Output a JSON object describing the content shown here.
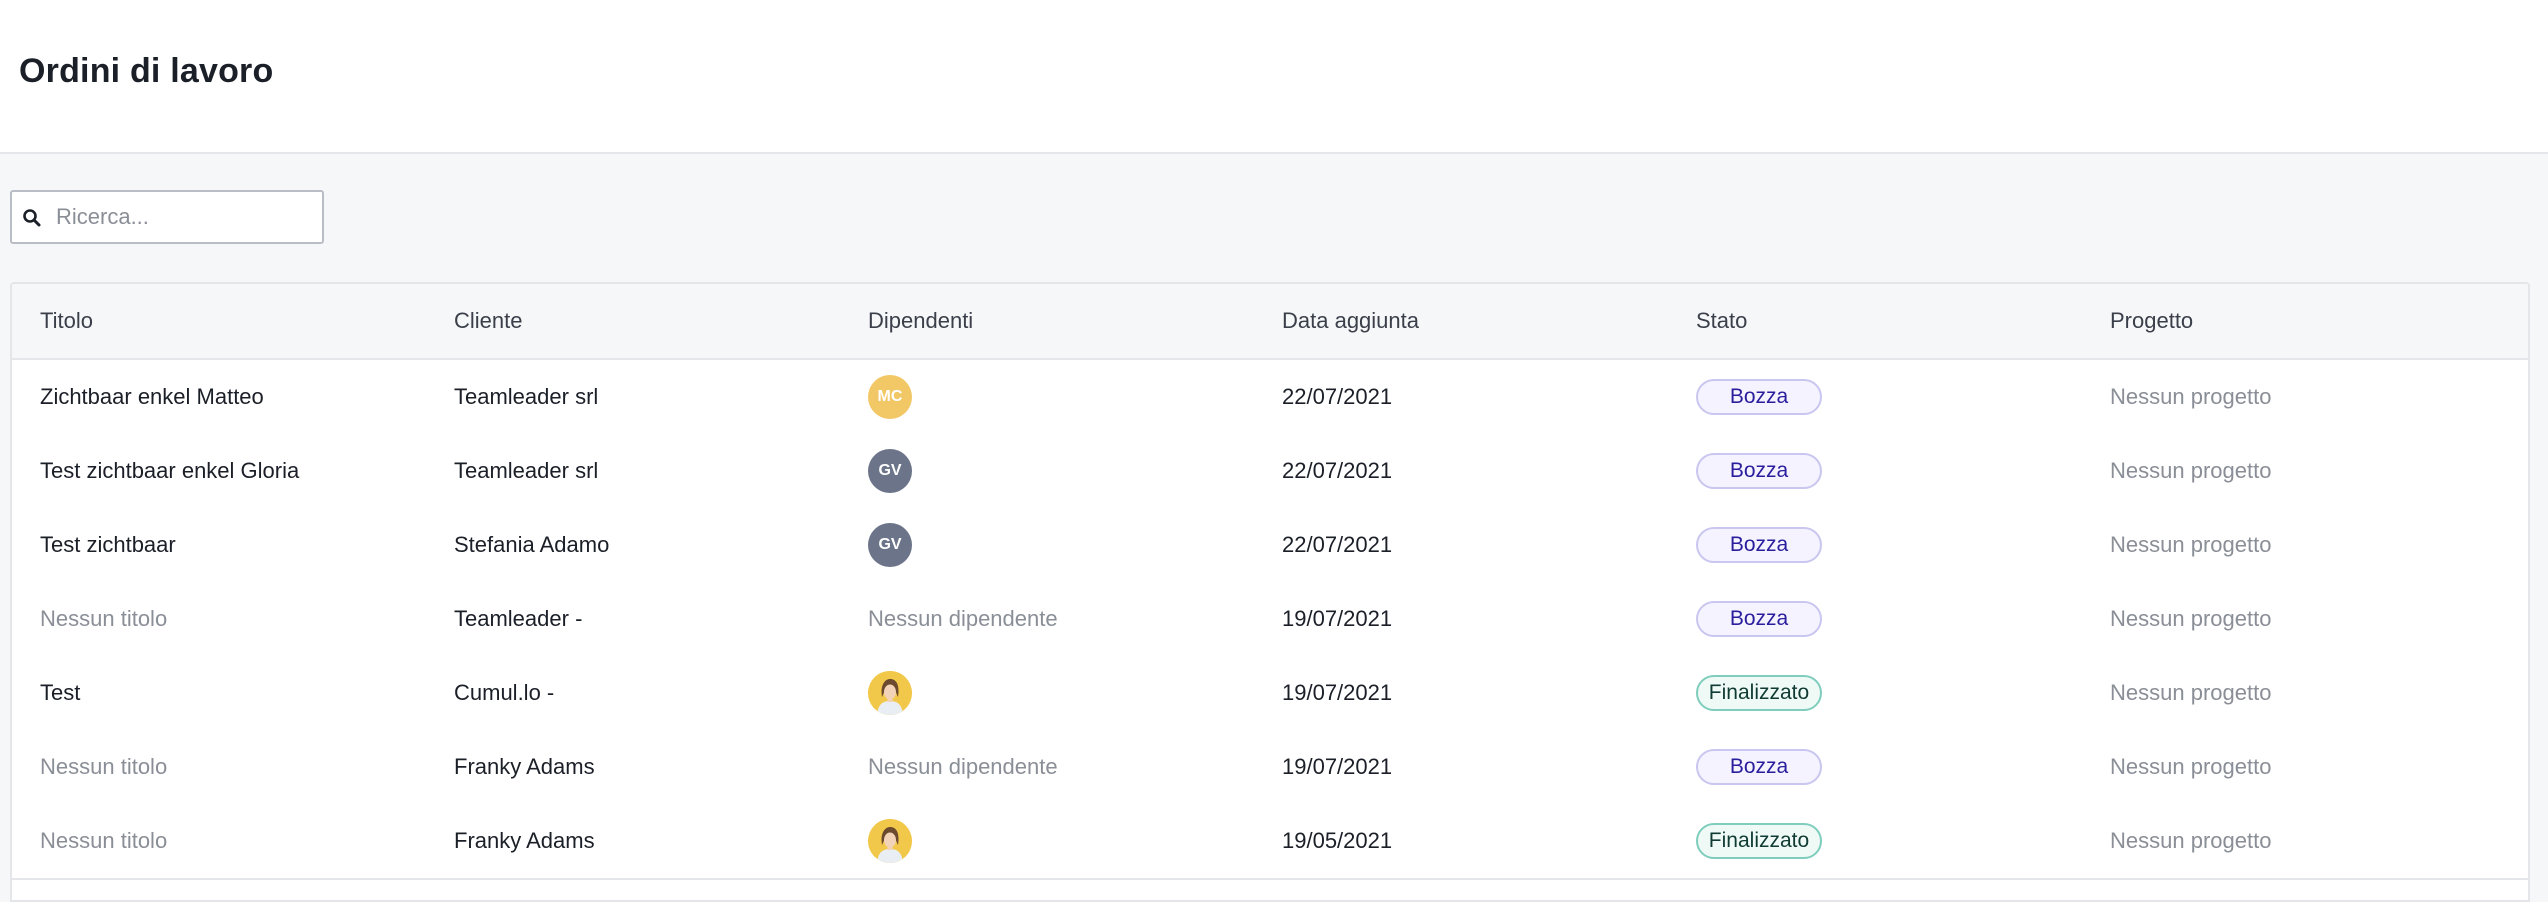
{
  "page": {
    "title": "Ordini di lavoro"
  },
  "search": {
    "placeholder": "Ricerca...",
    "value": ""
  },
  "table": {
    "columns": [
      "Titolo",
      "Cliente",
      "Dipendenti",
      "Data aggiunta",
      "Stato",
      "Progetto"
    ],
    "rows": [
      {
        "title": "Zichtbaar enkel Matteo",
        "client": "Teamleader srl",
        "employee": {
          "type": "initials",
          "text": "MC",
          "color": "#f2c866"
        },
        "date": "22/07/2021",
        "status": "Bozza",
        "project": "Nessun progetto"
      },
      {
        "title": "Test zichtbaar enkel Gloria",
        "client": "Teamleader srl",
        "employee": {
          "type": "initials",
          "text": "GV",
          "color": "#6b7489"
        },
        "date": "22/07/2021",
        "status": "Bozza",
        "project": "Nessun progetto"
      },
      {
        "title": "Test zichtbaar",
        "client": "Stefania Adamo",
        "employee": {
          "type": "initials",
          "text": "GV",
          "color": "#6b7489"
        },
        "date": "22/07/2021",
        "status": "Bozza",
        "project": "Nessun progetto"
      },
      {
        "title": "Nessun titolo",
        "client": "Teamleader -",
        "employee": {
          "type": "none",
          "text": "Nessun dipendente"
        },
        "date": "19/07/2021",
        "status": "Bozza",
        "project": "Nessun progetto"
      },
      {
        "title": "Test",
        "client": "Cumul.lo -",
        "employee": {
          "type": "photo",
          "color": "#f2c84b"
        },
        "date": "19/07/2021",
        "status": "Finalizzato",
        "project": "Nessun progetto"
      },
      {
        "title": "Nessun titolo",
        "client": "Franky Adams",
        "employee": {
          "type": "none",
          "text": "Nessun dipendente"
        },
        "date": "19/07/2021",
        "status": "Bozza",
        "project": "Nessun progetto"
      },
      {
        "title": "Nessun titolo",
        "client": "Franky Adams",
        "employee": {
          "type": "photo",
          "color": "#f2c84b"
        },
        "date": "19/05/2021",
        "status": "Finalizzato",
        "project": "Nessun progetto"
      }
    ]
  },
  "colors": {
    "draft_badge_text": "#2a1e9c",
    "final_badge_border": "#7fcdbd",
    "muted_text": "#8a8e96"
  }
}
